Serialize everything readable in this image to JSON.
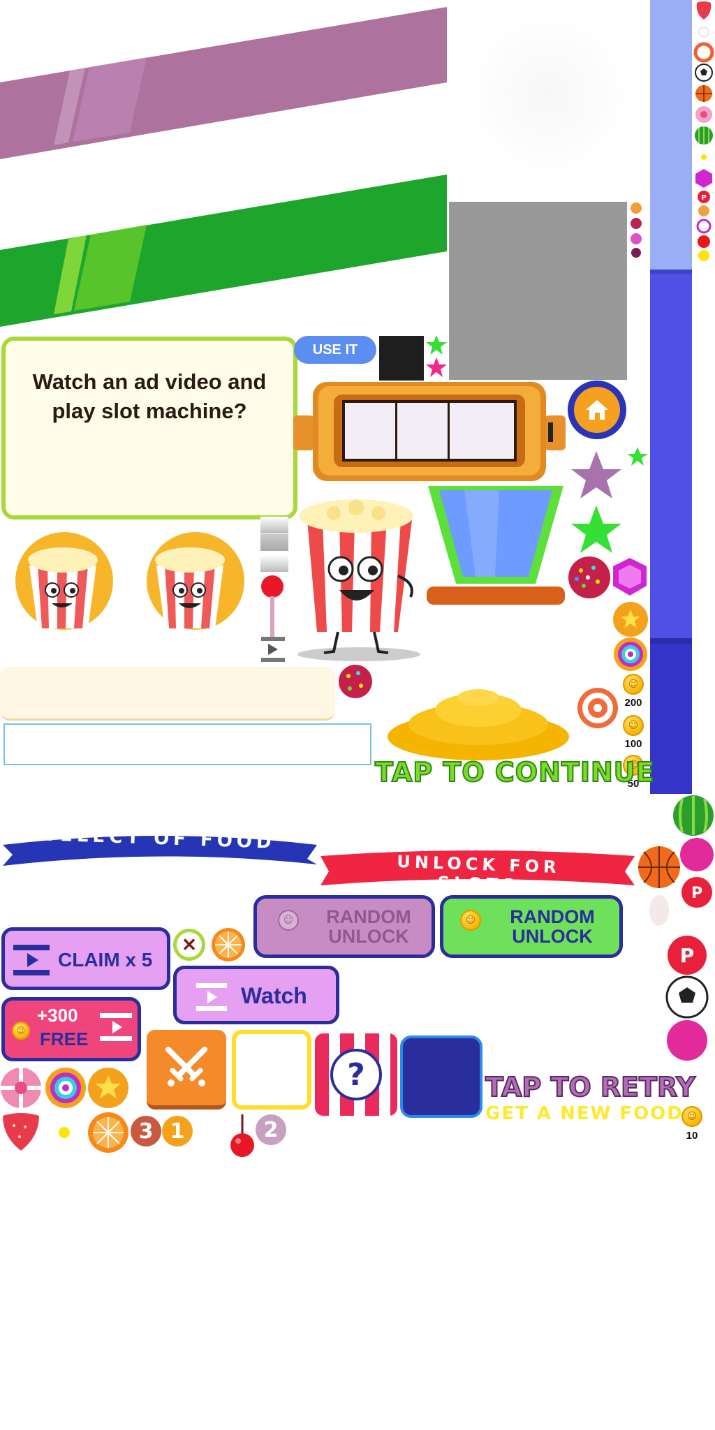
{
  "dialog": {
    "message": "Watch an ad video and play slot machine?"
  },
  "buttons": {
    "use_it": "USE IT",
    "random_unlock_disabled": "RANDOM UNLOCK",
    "random_unlock_active": "RANDOM UNLOCK",
    "claim": "CLAIM x 5",
    "watch": "Watch",
    "free_amount": "+300",
    "free_label": "FREE",
    "question_mark": "?"
  },
  "banners": {
    "select_food": "SELECT OF FOOD",
    "unlock_slots": "UNLOCK FOR SLOTS"
  },
  "prompts": {
    "tap_to_continue": "TAP TO CONTINUE",
    "tap_to_retry": "TAP TO RETRY",
    "get_new_food": "GET A NEW FOOD"
  },
  "coin_values": {
    "v200": "200",
    "v100": "100",
    "v50": "50",
    "v10": "10"
  },
  "number_badges": {
    "n3": "3",
    "n1": "1",
    "n2": "2"
  },
  "colors": {
    "purple_stripe": "#ad729d",
    "green_stripe": "#1ea52b",
    "dialog_border": "#a8d83a",
    "dialog_bg": "#fffdea",
    "use_it_bg": "#5b8ef0",
    "banner_blue": "#2535b5",
    "banner_red": "#ef2541",
    "bar_light": "#9aaef5",
    "bar_mid": "#5050e6",
    "bar_dark": "#3434c8",
    "claim_bg": "#e6a0f2",
    "button_border": "#2a2e9c",
    "random_active_bg": "#6ee05a",
    "random_disabled_bg": "#c88cc4",
    "free_bg": "#f0457c",
    "tap_continue_green": "#7edb2a",
    "tap_retry_purple": "#b46fb4",
    "get_food_yellow": "#ffe830"
  },
  "icons": [
    "popcorn-mascot",
    "slot-machine",
    "home-icon",
    "star-icon",
    "cup",
    "candy",
    "gem",
    "donut",
    "coin",
    "close-icon",
    "orange-slice",
    "watermelon",
    "basketball",
    "soccer-ball",
    "strawberry",
    "cherry",
    "swords-icon",
    "video-icon",
    "question-icon"
  ]
}
